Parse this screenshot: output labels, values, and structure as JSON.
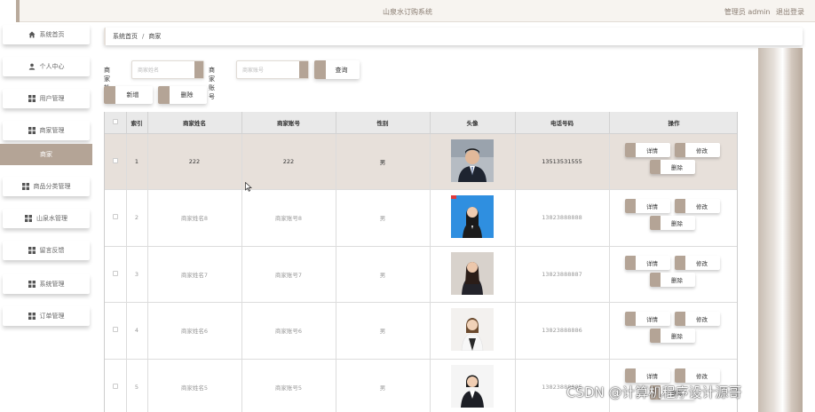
{
  "header": {
    "title": "山泉水订购系统",
    "user_label": "管理员 admin",
    "logout_label": "退出登录"
  },
  "sidebar": {
    "items": [
      {
        "label": "系统首页",
        "icon": "home-icon"
      },
      {
        "label": "个人中心",
        "icon": "user-icon"
      },
      {
        "label": "用户管理",
        "icon": "grid-icon"
      },
      {
        "label": "商家管理",
        "icon": "grid-icon"
      },
      {
        "label": "商家",
        "icon": ""
      },
      {
        "label": "商品分类管理",
        "icon": "grid-icon"
      },
      {
        "label": "山泉水管理",
        "icon": "grid-icon"
      },
      {
        "label": "留言反馈",
        "icon": "grid-icon"
      },
      {
        "label": "系统管理",
        "icon": "grid-icon"
      },
      {
        "label": "订单管理",
        "icon": "grid-icon"
      }
    ]
  },
  "breadcrumb": {
    "home": "系统首页",
    "sep": "/",
    "current": "商家"
  },
  "search": {
    "name_label": "商家姓名",
    "name_placeholder": "商家姓名",
    "account_label": "商家账号",
    "account_placeholder": "商家账号",
    "query_label": "查询"
  },
  "toolbar": {
    "add_label": "新增",
    "delete_label": "删除"
  },
  "table": {
    "headers": [
      "",
      "索引",
      "商家姓名",
      "商家账号",
      "性别",
      "头像",
      "电话号码",
      "操作"
    ],
    "rows": [
      {
        "index": "1",
        "name": "222",
        "account": "222",
        "gender": "男",
        "phone": "13513531555"
      },
      {
        "index": "2",
        "name": "商家姓名8",
        "account": "商家账号8",
        "gender": "男",
        "phone": "13823888888"
      },
      {
        "index": "3",
        "name": "商家姓名7",
        "account": "商家账号7",
        "gender": "男",
        "phone": "13823888887"
      },
      {
        "index": "4",
        "name": "商家姓名6",
        "account": "商家账号6",
        "gender": "男",
        "phone": "13823888886"
      },
      {
        "index": "5",
        "name": "商家姓名5",
        "account": "商家账号5",
        "gender": "男",
        "phone": "13823888885"
      }
    ],
    "actions": {
      "detail": "详情",
      "edit": "修改",
      "delete": "删除"
    }
  },
  "colors": {
    "accent": "#b4a496",
    "active_row": "#e7e0da",
    "header_bg": "#f7f4f0"
  },
  "watermark": "CSDN @计算机程序设计源哥"
}
